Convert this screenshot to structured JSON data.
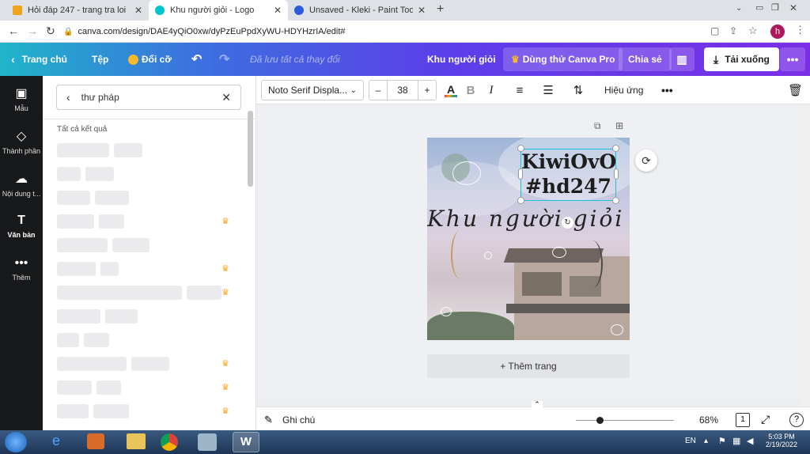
{
  "browser": {
    "tabs": [
      {
        "title": "Hỏi đáp 247 - trang tra loi",
        "favicon_color": "#f0a31c"
      },
      {
        "title": "Khu người giỏi - Logo",
        "favicon_color": "#00c4cc"
      },
      {
        "title": "Unsaved - Kleki - Paint Tool",
        "favicon_color": "#2b5bd7"
      }
    ],
    "url": "canva.com/design/DAE4yQiO0xw/dyPzEuPpdXyWU-HDYHzrIA/edit#",
    "avatar_letter": "h"
  },
  "header": {
    "home": "Trang chủ",
    "file": "Tệp",
    "resize": "Đổi cỡ",
    "saved_status": "Đã lưu tất cả thay đổi",
    "design_title": "Khu người giỏi",
    "try_pro": "Dùng thử Canva Pro",
    "share": "Chia sẻ",
    "download": "Tải xuống"
  },
  "rail": {
    "items": [
      {
        "label": "Mẫu",
        "icon": "template-icon"
      },
      {
        "label": "Thành phần",
        "icon": "elements-icon"
      },
      {
        "label": "Nội dung t...",
        "icon": "upload-icon"
      },
      {
        "label": "Văn bản",
        "icon": "text-icon"
      },
      {
        "label": "Thêm",
        "icon": "more-icon"
      }
    ]
  },
  "panel": {
    "search_value": "thư pháp",
    "results_title": "Tất cả kết quả"
  },
  "toolbar": {
    "font": "Noto Serif Displa...",
    "font_size": "38",
    "minus": "–",
    "plus": "+",
    "bold": "B",
    "italic": "I",
    "effects": "Hiệu ứng",
    "text_color": "#e8384f"
  },
  "canvas": {
    "text_line1": "KiwiOvO",
    "text_line2": "#hd247",
    "script_text": "Khu người giỏi",
    "add_page": "+ Thêm trang"
  },
  "footer": {
    "notes": "Ghi chú",
    "zoom": "68%",
    "zoom_level": 0.22,
    "page_num": "1"
  },
  "taskbar": {
    "lang": "EN",
    "time": "5:03 PM",
    "date": "2/19/2022"
  }
}
